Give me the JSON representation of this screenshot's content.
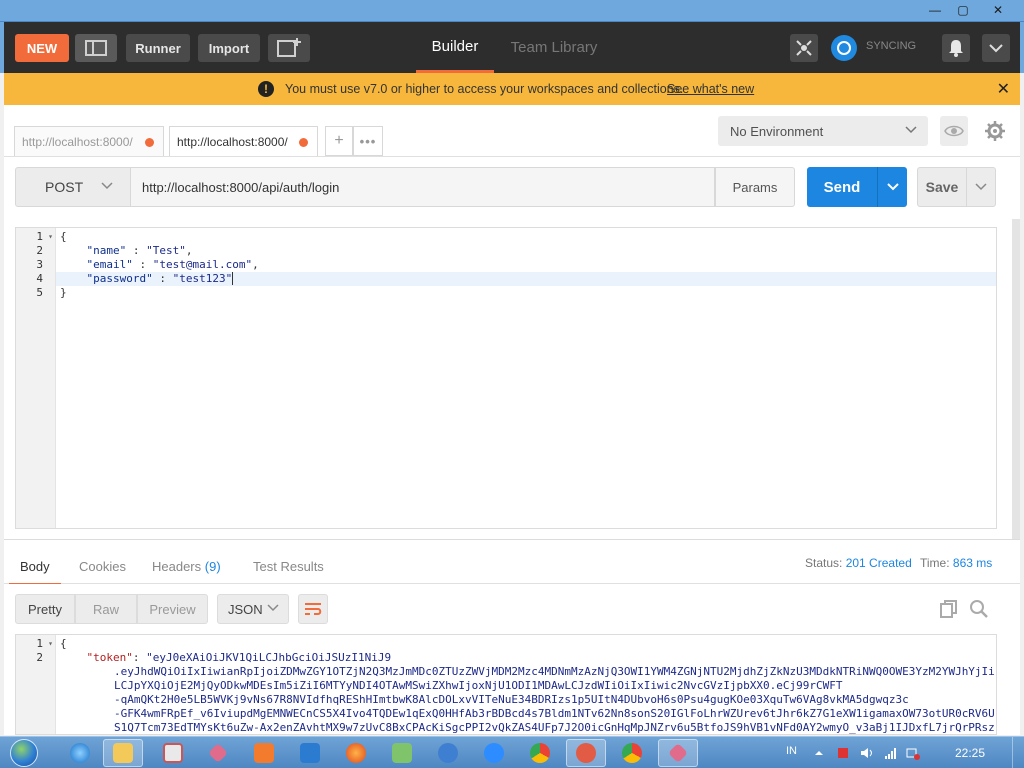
{
  "window": {
    "minimize": "—",
    "maximize": "▢",
    "close": "✕"
  },
  "header": {
    "new_label": "NEW",
    "runner_label": "Runner",
    "import_label": "Import",
    "tabs": [
      {
        "label": "Builder",
        "active": true
      },
      {
        "label": "Team Library",
        "active": false
      }
    ],
    "sync_label": "SYNCING"
  },
  "banner": {
    "icon": "!",
    "text": "You must use v7.0 or higher to access your workspaces and collections.",
    "link": "See what's new",
    "close": "✕"
  },
  "request_tabs": [
    {
      "label": "http://localhost:8000/",
      "unsaved": true,
      "active": false
    },
    {
      "label": "http://localhost:8000/",
      "unsaved": true,
      "active": true
    }
  ],
  "request_tabs_add": "+",
  "request_tabs_more": "•••",
  "environment": {
    "selected": "No Environment"
  },
  "request": {
    "method": "POST",
    "url": "http://localhost:8000/api/auth/login",
    "params_label": "Params",
    "send_label": "Send",
    "save_label": "Save"
  },
  "request_body_lines": [
    {
      "num": "1",
      "fold": "▾",
      "text": "{"
    },
    {
      "num": "2",
      "fold": "",
      "key": "\"name\"",
      "sep": " : ",
      "value": "\"Test\"",
      "tail": ","
    },
    {
      "num": "3",
      "fold": "",
      "key": "\"email\"",
      "sep": " : ",
      "value": "\"test@mail.com\"",
      "tail": ","
    },
    {
      "num": "4",
      "fold": "",
      "key": "\"password\"",
      "sep": " : ",
      "value": "\"test123\"",
      "tail": ""
    },
    {
      "num": "5",
      "fold": "",
      "text": "}"
    }
  ],
  "response": {
    "tabs": [
      "Body",
      "Cookies",
      "Headers",
      "Test Results"
    ],
    "headers_count": "(9)",
    "status_label": "Status:",
    "status_value": "201 Created",
    "time_label": "Time:",
    "time_value": "863 ms",
    "view_modes": [
      "Pretty",
      "Raw",
      "Preview"
    ],
    "format": "JSON",
    "lines": [
      {
        "num": "1",
        "fold": "▾",
        "text": "{"
      },
      {
        "num": "2",
        "fold": "",
        "key": "\"token\"",
        "value": "\"eyJ0eXAiOiJKV1QiLCJhbGciOiJSUzI1NiJ9"
      },
      {
        "num": "",
        "text": ".eyJhdWQiOiIxIiwianRpIjoiZDMwZGY1OTZjN2Q3MzJmMDc0ZTUzZWVjMDM2Mzc4MDNmMzAzNjQ3OWI1YWM4ZGNjNTU2MjdhZjZkNzU3MDdkNTRiNWQ0OWE3YzM2YWJhYjIi"
      },
      {
        "num": "",
        "text": "LCJpYXQiOjE2MjQyODkwMDEsIm5iZiI6MTYyNDI4OTAwMSwiZXhwIjoxNjU1ODI1MDAwLCJzdWIiOiIxIiwic2NvcGVzIjpbXX0.eCj99rCWFT"
      },
      {
        "num": "",
        "text": "-qAmQKt2H0e5LB5WVKj9vNs67R8NVIdfhqREShHImtbwK8AlcDOLxvVITeNuE34BDRIzs1p5UItN4DUbvoH6s0Psu4gugKOe03XquTw6VAg8vkMA5dgwqz3c"
      },
      {
        "num": "",
        "text": "-GFK4wmFRpEf_v6IviupdMgEMNWECnCS5X4Ivo4TQDEw1qExQ0HHfAb3rBDBcd4s7Bldm1NTv62Nn8sonS20IGlFoLhrWZUrev6tJhr6kZ7G1eXW1igamaxOW73otUR0cRV6U"
      },
      {
        "num": "",
        "text": "S1Q7Tcm73EdTMYsKt6uZw-Ax2enZAvhtMX9w7zUvC8BxCPAcKiSgcPPI2vQkZAS4UFp7J2O0icGnHqMpJNZrv6u5BtfoJS9hVB1vNFd0AY2wmyO_v3aBj1IJDxfL7jrQrPRsz"
      }
    ]
  },
  "taskbar": {
    "lang": "IN",
    "clock": "22:25"
  },
  "colors": {
    "accent": "#f26b3a",
    "send": "#1c86e0",
    "banner": "#f6b73c",
    "header_bg": "#2d2d2d"
  }
}
